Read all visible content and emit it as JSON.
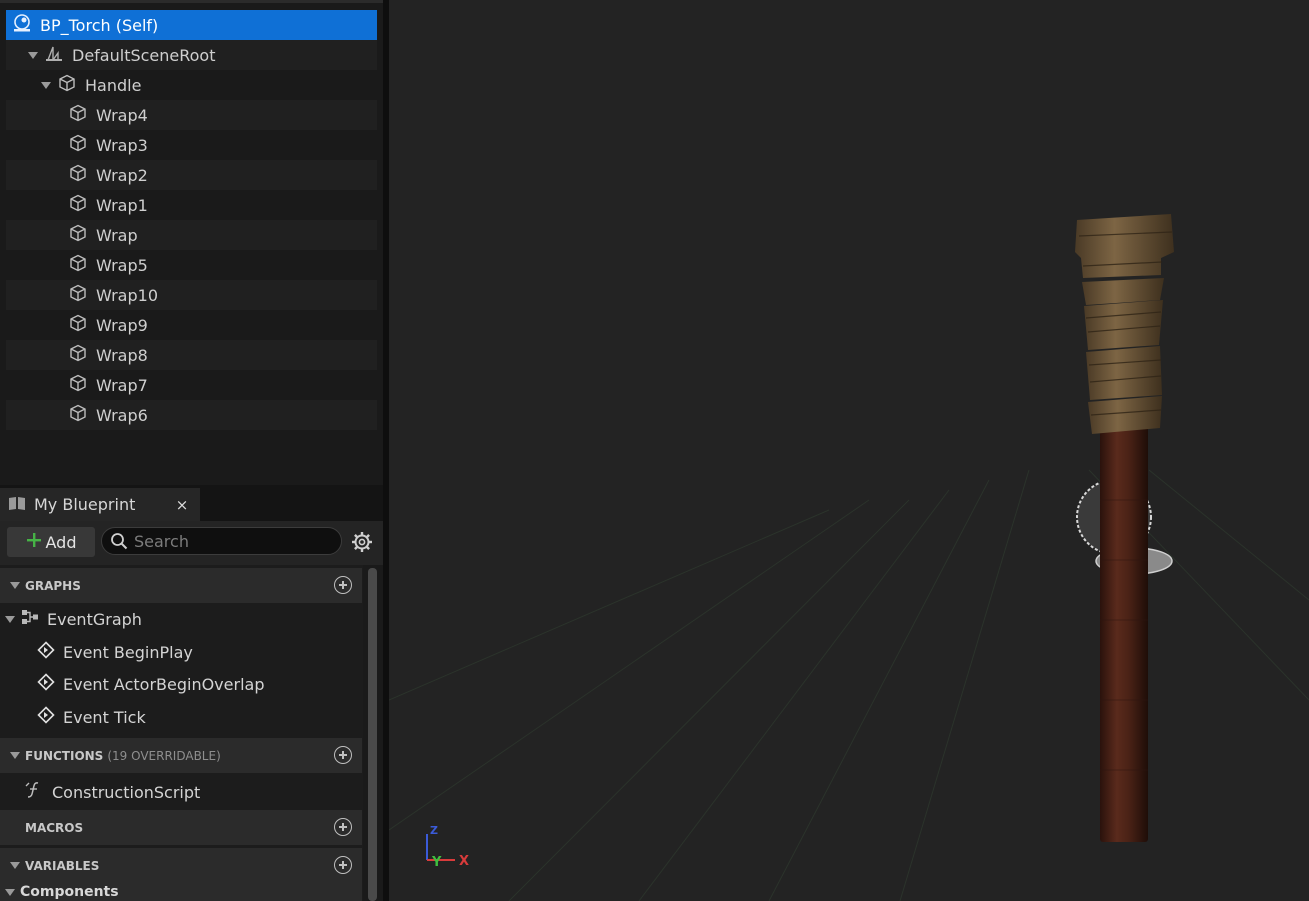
{
  "components_tree": {
    "root": {
      "label": "BP_Torch (Self)",
      "icon": "blueprint-self-icon"
    },
    "items": [
      {
        "label": "DefaultSceneRoot",
        "icon": "scene-root-icon",
        "expanded": true
      },
      {
        "label": "Handle",
        "icon": "static-mesh-icon",
        "expanded": true
      },
      {
        "label": "Wrap4",
        "icon": "static-mesh-icon"
      },
      {
        "label": "Wrap3",
        "icon": "static-mesh-icon"
      },
      {
        "label": "Wrap2",
        "icon": "static-mesh-icon"
      },
      {
        "label": "Wrap1",
        "icon": "static-mesh-icon"
      },
      {
        "label": "Wrap",
        "icon": "static-mesh-icon"
      },
      {
        "label": "Wrap5",
        "icon": "static-mesh-icon"
      },
      {
        "label": "Wrap10",
        "icon": "static-mesh-icon"
      },
      {
        "label": "Wrap9",
        "icon": "static-mesh-icon"
      },
      {
        "label": "Wrap8",
        "icon": "static-mesh-icon"
      },
      {
        "label": "Wrap7",
        "icon": "static-mesh-icon"
      },
      {
        "label": "Wrap6",
        "icon": "static-mesh-icon"
      }
    ]
  },
  "my_blueprint": {
    "tab_label": "My Blueprint",
    "tab_close": "×",
    "add_label": "Add",
    "search_placeholder": "Search",
    "sections": {
      "graphs": {
        "label": "GRAPHS"
      },
      "functions": {
        "label": "FUNCTIONS",
        "sub": "(19 OVERRIDABLE)"
      },
      "macros": {
        "label": "MACROS"
      },
      "variables": {
        "label": "VARIABLES"
      },
      "components": {
        "label": "Components"
      }
    },
    "event_graph": "EventGraph",
    "events": [
      "Event BeginPlay",
      "Event ActorBeginOverlap",
      "Event Tick"
    ],
    "functions": [
      "ConstructionScript"
    ]
  },
  "viewport": {
    "axis_labels": {
      "x": "X",
      "y": "Y",
      "z": "Z"
    }
  },
  "colors": {
    "selection": "#0f70d6",
    "panel_bg": "#1a1a1a",
    "viewport_bg": "#232323"
  }
}
